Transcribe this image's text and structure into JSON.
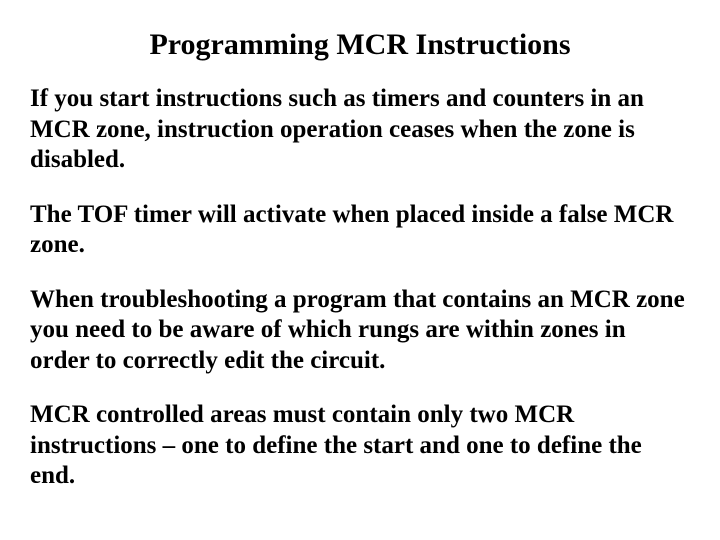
{
  "title": "Programming MCR Instructions",
  "paragraphs": [
    "If you start instructions such as timers and counters in an MCR zone, instruction operation ceases when the zone is disabled.",
    "The TOF timer will activate when placed inside a false MCR zone.",
    "When troubleshooting a program that contains an MCR zone you need to be aware of which rungs are within zones in order to correctly edit the circuit.",
    "MCR controlled areas must contain only two MCR instructions – one to define the start and one to define the end."
  ]
}
